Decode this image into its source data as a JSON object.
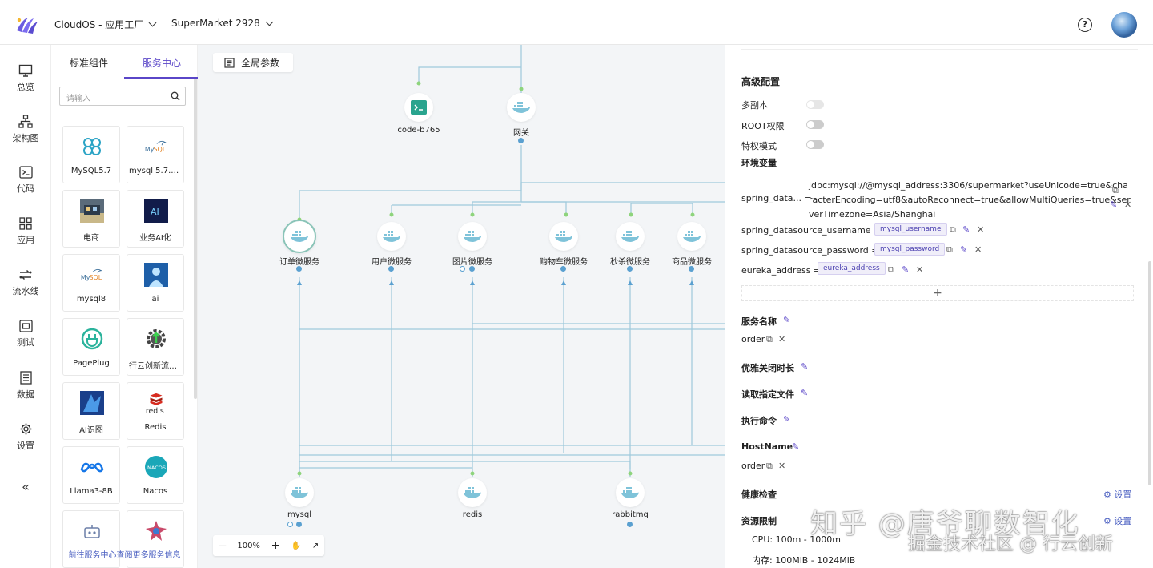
{
  "header": {
    "app_dropdown": "CloudOS - 应用工厂",
    "project_dropdown": "SuperMarket 2928"
  },
  "leftnav": [
    {
      "label": "总览",
      "icon": "monitor-icon"
    },
    {
      "label": "架构图",
      "icon": "sitemap-icon"
    },
    {
      "label": "代码",
      "icon": "terminal-icon"
    },
    {
      "label": "应用",
      "icon": "grid-icon"
    },
    {
      "label": "流水线",
      "icon": "pipeline-icon"
    },
    {
      "label": "测试",
      "icon": "test-icon"
    },
    {
      "label": "数据",
      "icon": "data-icon"
    },
    {
      "label": "设置",
      "icon": "gear-icon"
    }
  ],
  "panel": {
    "tabs": [
      "标准组件",
      "服务中心"
    ],
    "active_tab": "服务中心",
    "search_placeholder": "请输入",
    "cards": [
      {
        "label": "MySQL5.7",
        "icon": "mysql-cluster-icon"
      },
      {
        "label": "mysql 5.7.29 ...",
        "icon": "mysql-logo-icon"
      },
      {
        "label": "电商",
        "icon": "shop-image-icon"
      },
      {
        "label": "业务AI化",
        "icon": "ai-icon"
      },
      {
        "label": "mysql8",
        "icon": "mysql-logo-icon"
      },
      {
        "label": "ai",
        "icon": "ai-person-icon"
      },
      {
        "label": "PagePlug",
        "icon": "plug-icon"
      },
      {
        "label": "行云创新流程...",
        "icon": "gear-upload-icon"
      },
      {
        "label": "AI识图",
        "icon": "ai-vision-icon"
      },
      {
        "label": "Redis",
        "icon": "redis-icon"
      },
      {
        "label": "Llama3-8B",
        "icon": "meta-icon"
      },
      {
        "label": "Nacos",
        "icon": "nacos-icon"
      },
      {
        "label": "",
        "icon": "robot-icon"
      },
      {
        "label": "",
        "icon": "puzzle-icon"
      }
    ],
    "footer_link": "前往服务中心查阅更多服务信息",
    "redis_logo_text": "redis",
    "nacos_logo_text": "NACOS",
    "ai_logo_text": "AI"
  },
  "canvas": {
    "global_params": "全局参数",
    "zoom": "100%",
    "nodes": [
      {
        "label": "code-b765",
        "icon": "terminal-icon"
      },
      {
        "label": "网关",
        "icon": "docker-icon"
      },
      {
        "label": "订单微服务",
        "icon": "docker-icon"
      },
      {
        "label": "用户微服务",
        "icon": "docker-icon"
      },
      {
        "label": "图片微服务",
        "icon": "docker-icon"
      },
      {
        "label": "购物车微服务",
        "icon": "docker-icon"
      },
      {
        "label": "秒杀微服务",
        "icon": "docker-icon"
      },
      {
        "label": "商品微服务",
        "icon": "docker-icon"
      },
      {
        "label": "mysql",
        "icon": "docker-icon"
      },
      {
        "label": "redis",
        "icon": "docker-icon"
      },
      {
        "label": "rabbitmq",
        "icon": "docker-icon"
      }
    ]
  },
  "right": {
    "advanced_title": "高级配置",
    "toggles": [
      {
        "label": "多副本",
        "on": false,
        "disabled": true
      },
      {
        "label": "ROOT权限",
        "on": false,
        "disabled": false
      },
      {
        "label": "特权模式",
        "on": false,
        "disabled": false
      }
    ],
    "env_title": "环境变量",
    "env": [
      {
        "key": "spring_data... =",
        "value": "jdbc:mysql://@mysql_address:3306/supermarket?useUnicode=true&cha racterEncoding=utf8&autoReconnect=true&allowMultiQueries=true&ser verTimezone=Asia/Shanghai",
        "value_lines": [
          "jdbc:mysql://@mysql_address:3306/supermarket?useUnicode=true&cha",
          "racterEncoding=utf8&autoReconnect=true&allowMultiQueries=true&ser",
          "verTimezone=Asia/Shanghai"
        ]
      },
      {
        "key": "spring_datasource_username =",
        "tag": "mysql_username"
      },
      {
        "key": "spring_datasource_password =",
        "tag": "mysql_password"
      },
      {
        "key": "eureka_address =",
        "tag": "eureka_address"
      }
    ],
    "add_symbol": "+",
    "service_name_title": "服务名称",
    "service_name_value": "order",
    "graceful_title": "优雅关闭时长",
    "read_file_title": "读取指定文件",
    "exec_title": "执行命令",
    "hostname_title": "HostName",
    "hostname_value": "order",
    "health_title": "健康检查",
    "health_action": "设置",
    "resource_title": "资源限制",
    "resource_action": "设置",
    "cpu": "CPU: 100m - 1000m",
    "memory": "内存: 100MiB - 1024MiB"
  },
  "watermark": {
    "line1": "知乎 @唐爷聊数智化",
    "line2": "掘金技术社区 @ 行云创新"
  }
}
